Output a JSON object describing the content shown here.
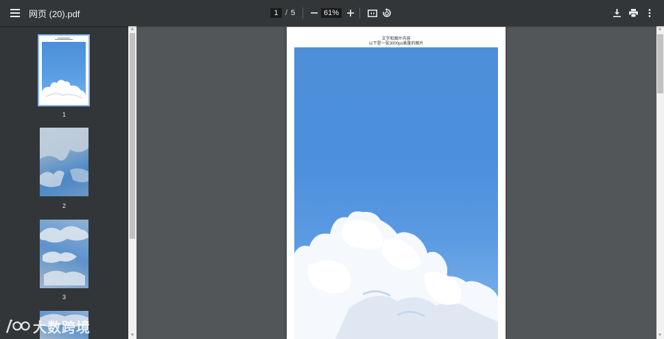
{
  "toolbar": {
    "title": "网页 (20).pdf",
    "current_page": "1",
    "page_separator": "/",
    "total_pages": "5",
    "zoom": "61%"
  },
  "sidebar": {
    "thumbnails": [
      {
        "label": "1"
      },
      {
        "label": "2"
      },
      {
        "label": "3"
      }
    ]
  },
  "page": {
    "line1": "文字和图片内容",
    "line2": "以下是一张3000px高度的图片"
  },
  "watermark": {
    "brand": "大数跨境"
  },
  "colors": {
    "toolbar_bg": "#323639",
    "viewer_bg": "#525659",
    "selected_border": "#8ab4f8"
  }
}
